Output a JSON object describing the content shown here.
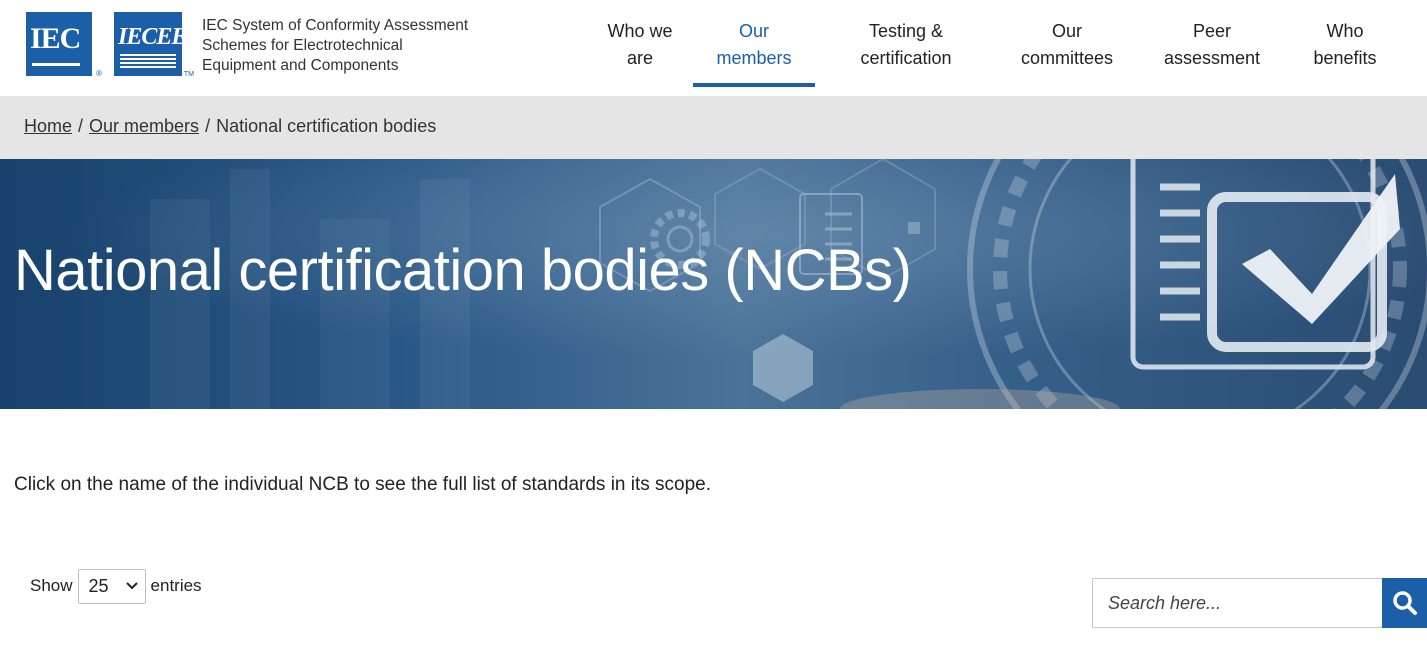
{
  "header": {
    "logo_iec_text": "IEC",
    "logo_iecee_text": "IECEE",
    "org_name_line1": "IEC System of Conformity Assessment",
    "org_name_line2": "Schemes for Electrotechnical",
    "org_name_line3": "Equipment and Components",
    "nav": [
      {
        "line1": "Who we",
        "line2": "are",
        "active": false
      },
      {
        "line1": "Our",
        "line2": "members",
        "active": true
      },
      {
        "line1": "Testing &",
        "line2": "certification",
        "active": false
      },
      {
        "line1": "Our",
        "line2": "committees",
        "active": false
      },
      {
        "line1": "Peer",
        "line2": "assessment",
        "active": false
      },
      {
        "line1": "Who",
        "line2": "benefits",
        "active": false
      }
    ]
  },
  "breadcrumb": {
    "home": "Home",
    "sep": "/",
    "members": "Our members",
    "current": "National certification bodies"
  },
  "hero": {
    "title": "National certification bodies (NCBs)"
  },
  "content": {
    "intro": "Click on the name of the individual NCB to see the full list of standards in its scope.",
    "show_label": "Show",
    "entries_value": "25",
    "entries_label": "entries",
    "search_placeholder": "Search here..."
  },
  "colors": {
    "brand_blue": "#1a5fa8",
    "breadcrumb_bg": "#e5e5e5",
    "hero_dark": "#17426d"
  },
  "icons": {
    "search": "search-icon",
    "select_chevron": "chevron-down-icon"
  }
}
